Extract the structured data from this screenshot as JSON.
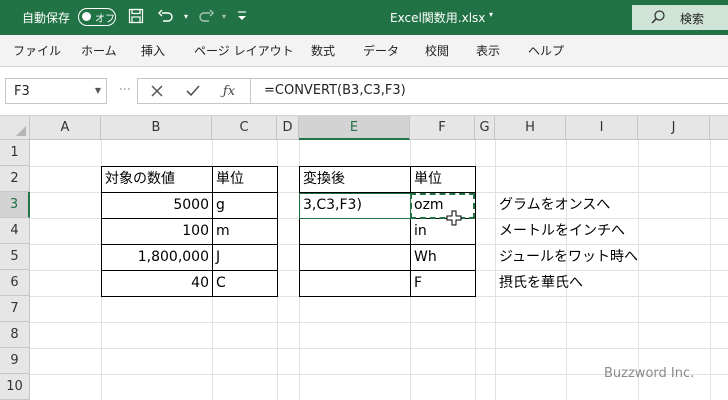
{
  "titlebar": {
    "autosave_label": "自動保存",
    "autosave_state": "オフ",
    "filename": "Excel関数用.xlsx",
    "search_label": "検索",
    "icons": [
      "save-icon",
      "undo-icon",
      "redo-icon",
      "customize-qat-icon"
    ]
  },
  "ribbon": {
    "tabs": [
      "ファイル",
      "ホーム",
      "挿入",
      "ページ レイアウト",
      "数式",
      "データ",
      "校閲",
      "表示",
      "ヘルプ"
    ]
  },
  "formula_bar": {
    "name_box": "F3",
    "formula": "=CONVERT(B3,C3,F3)"
  },
  "grid": {
    "columns": [
      "A",
      "B",
      "C",
      "D",
      "E",
      "F",
      "G",
      "H",
      "I",
      "J"
    ],
    "rows": [
      "1",
      "2",
      "3",
      "4",
      "5",
      "6",
      "7",
      "8",
      "9",
      "10"
    ],
    "selected_column": "E",
    "selected_row": "3",
    "cells": {
      "B2": "対象の数値",
      "C2": "単位",
      "B3": "5000",
      "C3": "g",
      "B4": "100",
      "C4": "m",
      "B5": "1,800,000",
      "C5": "J",
      "B6": "40",
      "C6": "C",
      "E2": "変換後",
      "F2": "単位",
      "E3": "3,C3,F3)",
      "F3": "ozm",
      "F4": "in",
      "F5": "Wh",
      "F6": "F",
      "H3": "グラムをオンスへ",
      "H4": "メートルをインチへ",
      "H5": "ジュールをワット時へ",
      "H6": "摂氏を華氏へ"
    }
  },
  "watermark": "Buzzword Inc.",
  "colors": {
    "accent": "#217346",
    "header_bg": "#e6e6e6",
    "gridline": "#e1e1e1"
  }
}
